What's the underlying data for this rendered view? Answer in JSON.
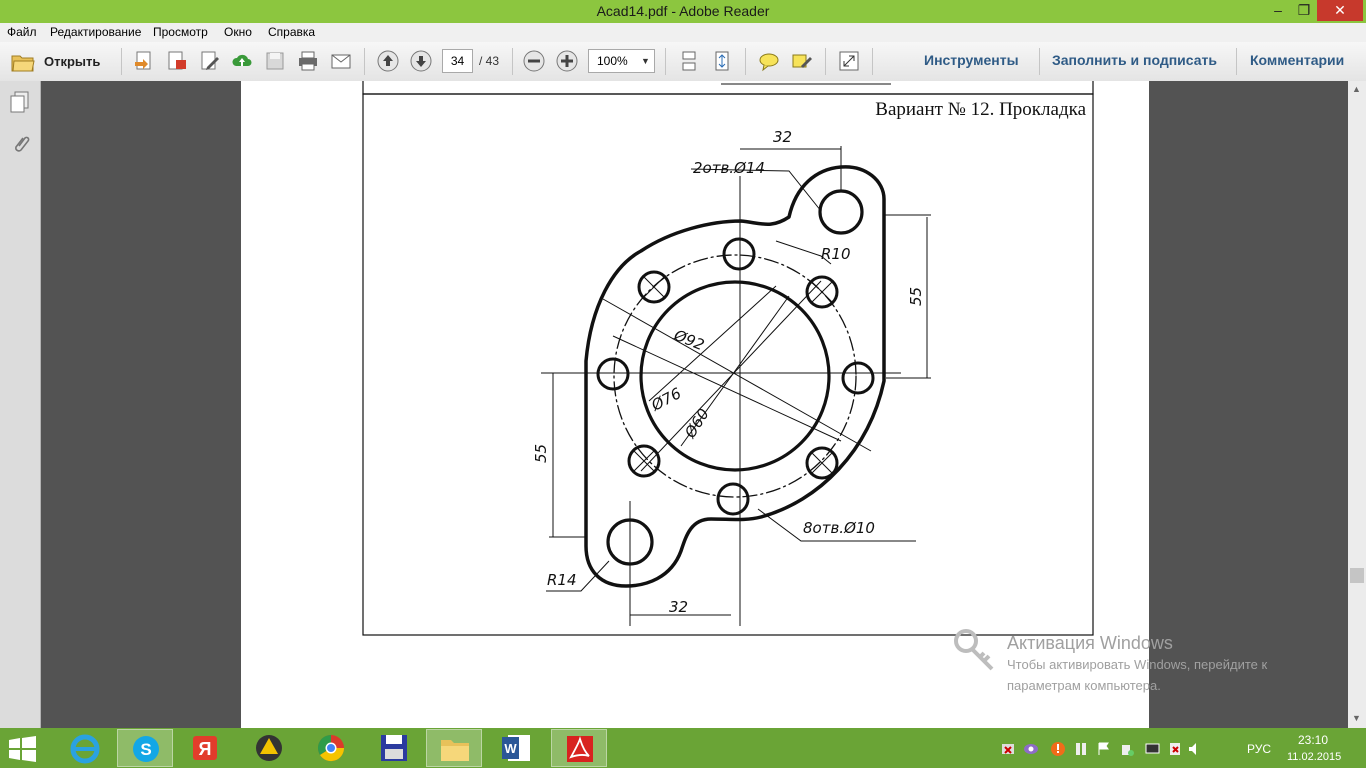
{
  "window": {
    "title": "Acad14.pdf - Adobe Reader"
  },
  "menu": [
    "Файл",
    "Редактирование",
    "Просмотр",
    "Окно",
    "Справка"
  ],
  "toolbar": {
    "open_label": "Открыть",
    "page_current": "34",
    "page_total": "/ 43",
    "zoom": "100%",
    "tools_label": "Инструменты",
    "fill_sign_label": "Заполнить и подписать",
    "comments_label": "Комментарии"
  },
  "document": {
    "variant_title": "Вариант № 12. Прокладка",
    "dims": {
      "top_32": "32",
      "holes_2": "2отв.Ø14",
      "r10": "R10",
      "d92": "Ø92",
      "d76": "Ø76",
      "d60": "Ø60",
      "right_55": "55",
      "left_55": "55",
      "holes_8": "8отв.Ø10",
      "r14": "R14",
      "bottom_32": "32"
    }
  },
  "watermark": {
    "title": "Активация Windows",
    "line1": "Чтобы активировать Windows, перейдите к",
    "line2": "параметрам компьютера."
  },
  "taskbar": {
    "lang": "РУС",
    "time": "23:10",
    "date": "11.02.2015"
  },
  "colors": {
    "titlebar": "#8cc63f",
    "taskbar": "#6aa436",
    "close": "#c7392c",
    "link": "#2f5b86"
  }
}
